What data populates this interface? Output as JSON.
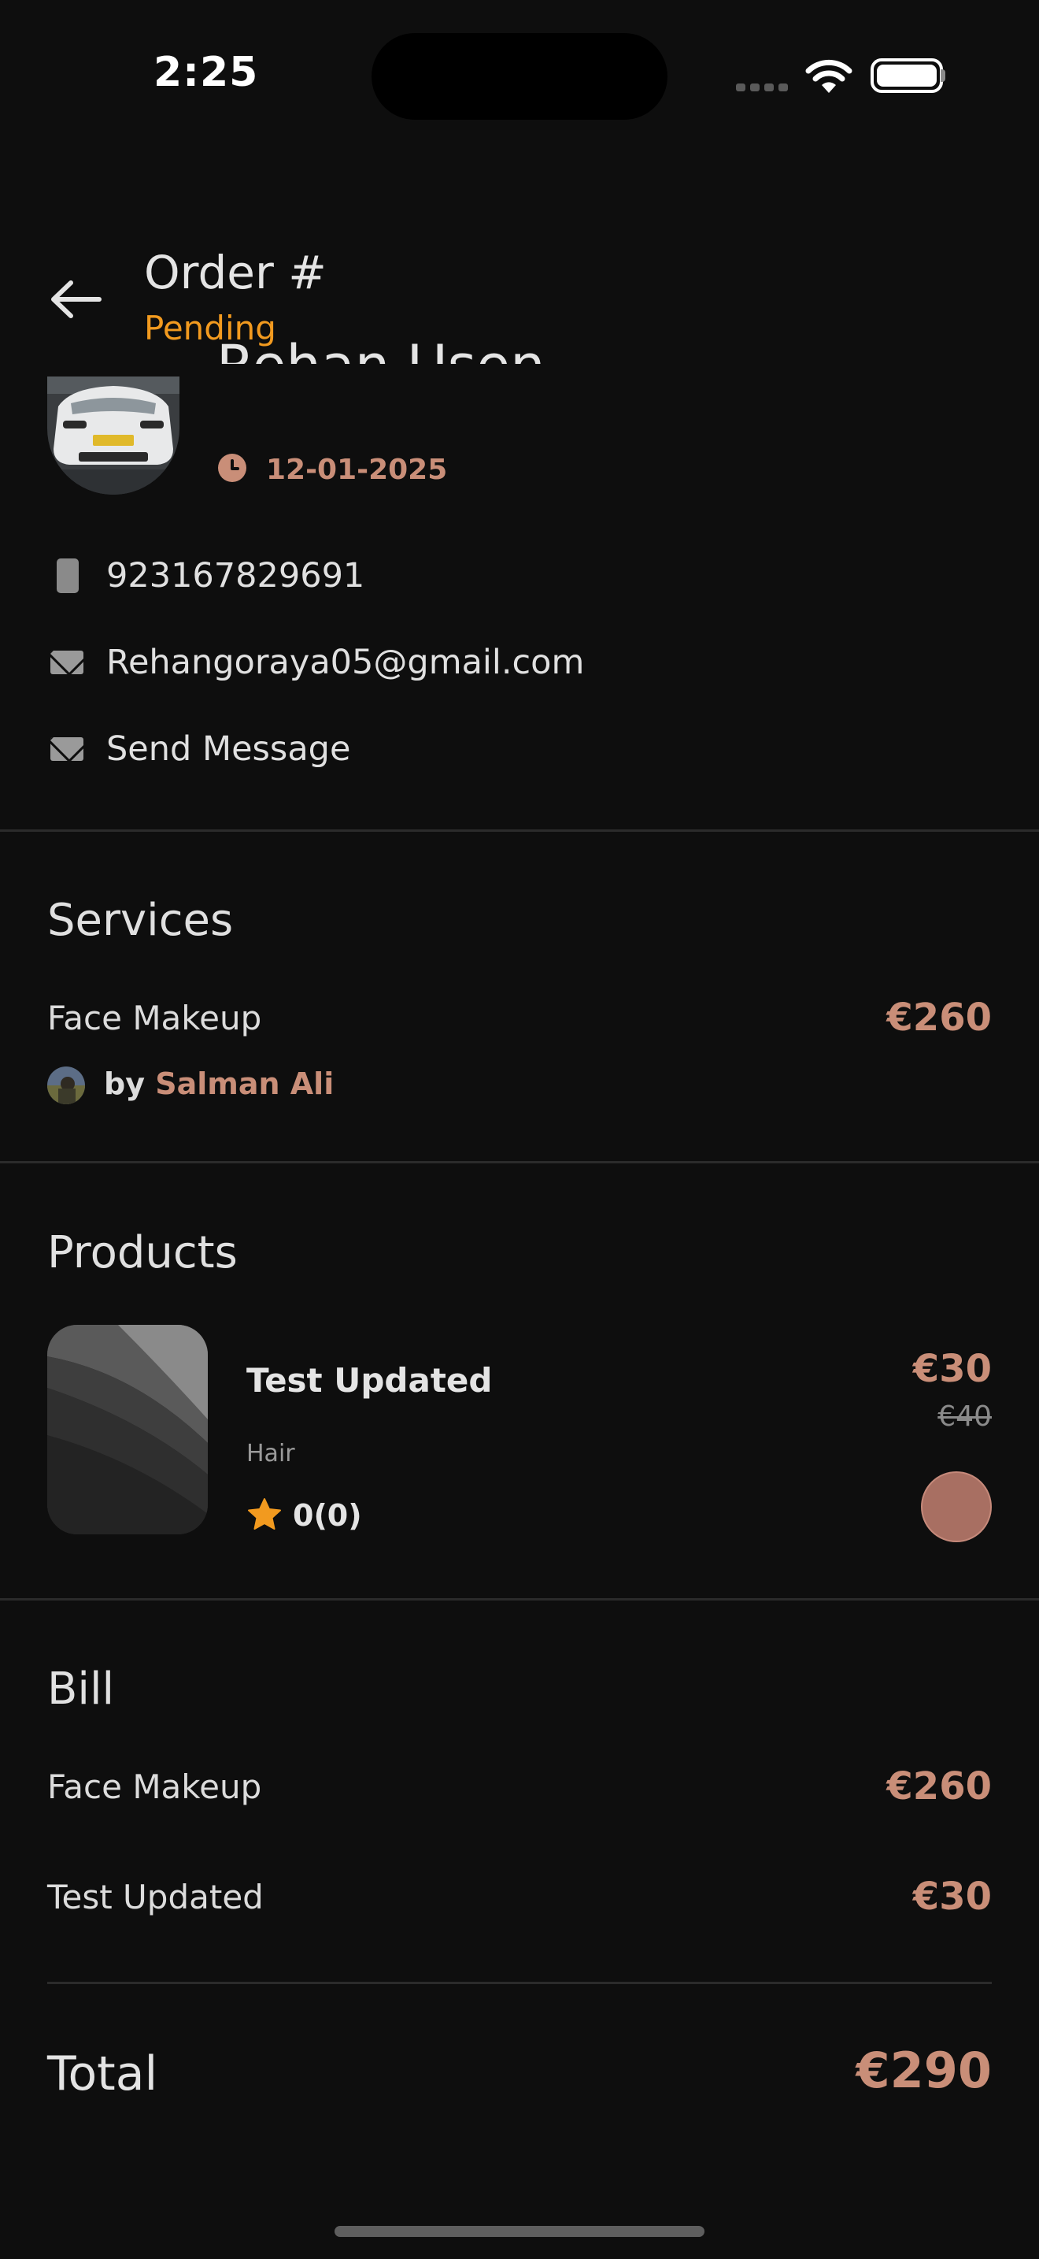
{
  "status_bar": {
    "time": "2:25"
  },
  "header": {
    "title": "Order #",
    "status": "Pending"
  },
  "customer": {
    "name": "Rehan Usen",
    "date": "12-01-2025",
    "phone": "923167829691",
    "email": "Rehangoraya05@gmail.com",
    "message_label": "Send Message"
  },
  "services": {
    "title": "Services",
    "items": [
      {
        "name": "Face Makeup",
        "price": "€260",
        "by": "by",
        "provider": "Salman Ali"
      }
    ]
  },
  "products": {
    "title": "Products",
    "items": [
      {
        "name": "Test Updated",
        "category": "Hair",
        "rating": "0(0)",
        "price": "€30",
        "old_price": "€40",
        "color": "#a86f62"
      }
    ]
  },
  "bill": {
    "title": "Bill",
    "lines": [
      {
        "label": "Face Makeup",
        "amount": "€260"
      },
      {
        "label": "Test Updated",
        "amount": "€30"
      }
    ],
    "total_label": "Total",
    "total_amount": "€290"
  },
  "colors": {
    "accent": "#c98e78",
    "status": "#f29a1f",
    "background": "#0e0e0e"
  }
}
